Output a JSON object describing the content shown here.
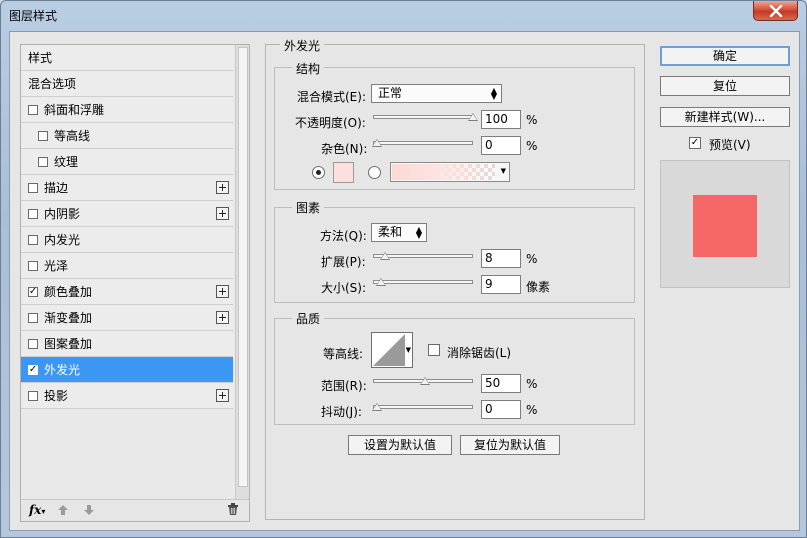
{
  "window": {
    "title": "图层样式"
  },
  "sidebar": {
    "items": [
      {
        "label": "样式",
        "type": "header"
      },
      {
        "label": "混合选项",
        "type": "header"
      },
      {
        "label": "斜面和浮雕",
        "type": "check",
        "checked": false
      },
      {
        "label": "等高线",
        "type": "check",
        "checked": false,
        "indent": true
      },
      {
        "label": "纹理",
        "type": "check",
        "checked": false,
        "indent": true
      },
      {
        "label": "描边",
        "type": "check",
        "checked": false,
        "plus": true
      },
      {
        "label": "内阴影",
        "type": "check",
        "checked": false,
        "plus": true
      },
      {
        "label": "内发光",
        "type": "check",
        "checked": false
      },
      {
        "label": "光泽",
        "type": "check",
        "checked": false
      },
      {
        "label": "颜色叠加",
        "type": "check",
        "checked": true,
        "plus": true
      },
      {
        "label": "渐变叠加",
        "type": "check",
        "checked": false,
        "plus": true
      },
      {
        "label": "图案叠加",
        "type": "check",
        "checked": false
      },
      {
        "label": "外发光",
        "type": "check",
        "checked": true,
        "selected": true
      },
      {
        "label": "投影",
        "type": "check",
        "checked": false,
        "plus": true
      }
    ],
    "fx_label": "fx"
  },
  "outer_glow": {
    "title": "外发光",
    "structure": {
      "title": "结构",
      "blend_mode_label": "混合模式(E):",
      "blend_mode_value": "正常",
      "opacity_label": "不透明度(O):",
      "opacity_value": "100",
      "opacity_level": 100,
      "noise_label": "杂色(N):",
      "noise_value": "0",
      "noise_level": 0,
      "percent": "%",
      "swatch_color": "#fde0de"
    },
    "elements": {
      "title": "图素",
      "technique_label": "方法(Q):",
      "technique_value": "柔和",
      "spread_label": "扩展(P):",
      "spread_value": "8",
      "spread_level": 8,
      "size_label": "大小(S):",
      "size_value": "9",
      "size_level": 4,
      "size_unit": "像素",
      "percent": "%"
    },
    "quality": {
      "title": "品质",
      "contour_label": "等高线:",
      "antialias_label": "消除锯齿(L)",
      "range_label": "范围(R):",
      "range_value": "50",
      "range_level": 50,
      "jitter_label": "抖动(J):",
      "jitter_value": "0",
      "jitter_level": 0,
      "percent": "%"
    },
    "make_default_label": "设置为默认值",
    "reset_default_label": "复位为默认值"
  },
  "actions": {
    "ok_label": "确定",
    "reset_label": "复位",
    "new_style_label": "新建样式(W)...",
    "preview_label": "预览(V)",
    "preview_checked": true,
    "preview_color": "#f56765"
  }
}
